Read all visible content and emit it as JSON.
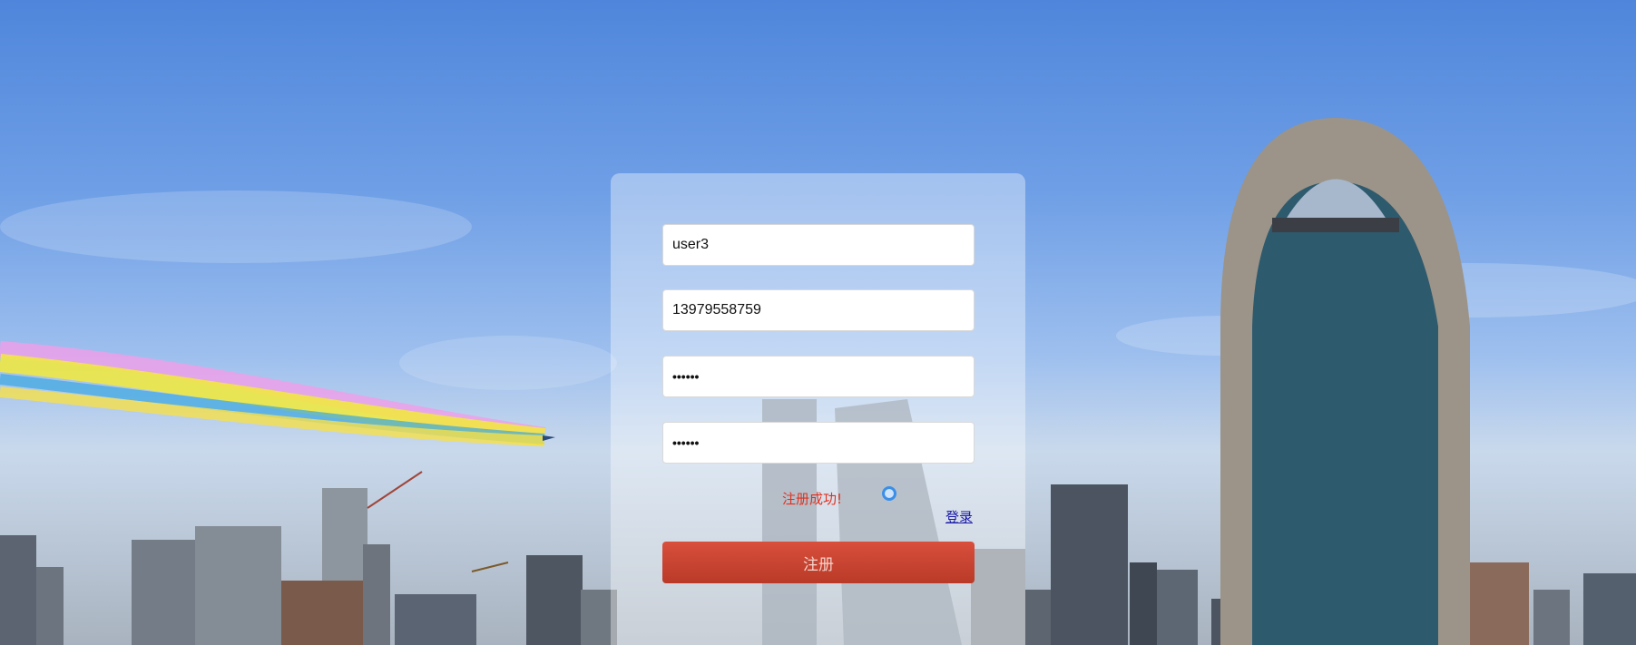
{
  "form": {
    "username_value": "user3",
    "phone_value": "13979558759",
    "password_value": "••••••",
    "confirm_password_value": "••••••",
    "status_message": "注册成功!",
    "login_link": "登录",
    "register_button": "注册"
  },
  "colors": {
    "status_message": "#e0301e",
    "register_button": "#c8432f",
    "login_link": "#1a1aa6"
  }
}
